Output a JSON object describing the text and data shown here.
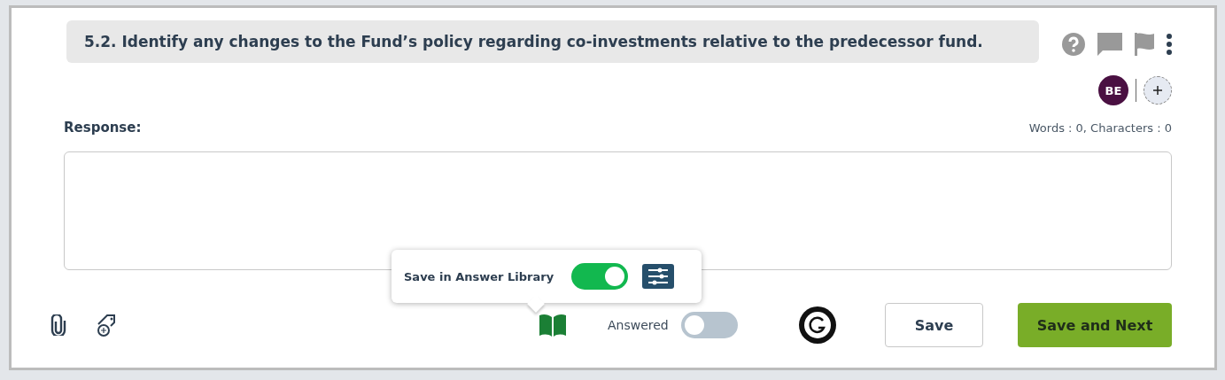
{
  "question": {
    "text": "5.2. Identify any changes to the Fund’s policy regarding co-investments relative to the predecessor fund."
  },
  "assignees": [
    {
      "initials": "BE",
      "color": "#4a1042"
    }
  ],
  "response": {
    "label": "Response:",
    "counter": "Words : 0, Characters : 0"
  },
  "library_popover": {
    "label": "Save in Answer Library",
    "on": true
  },
  "answered": {
    "label": "Answered",
    "on": false
  },
  "buttons": [
    {
      "label": "Save",
      "kind": "secondary"
    },
    {
      "label": "Save and Next",
      "kind": "primary"
    }
  ]
}
